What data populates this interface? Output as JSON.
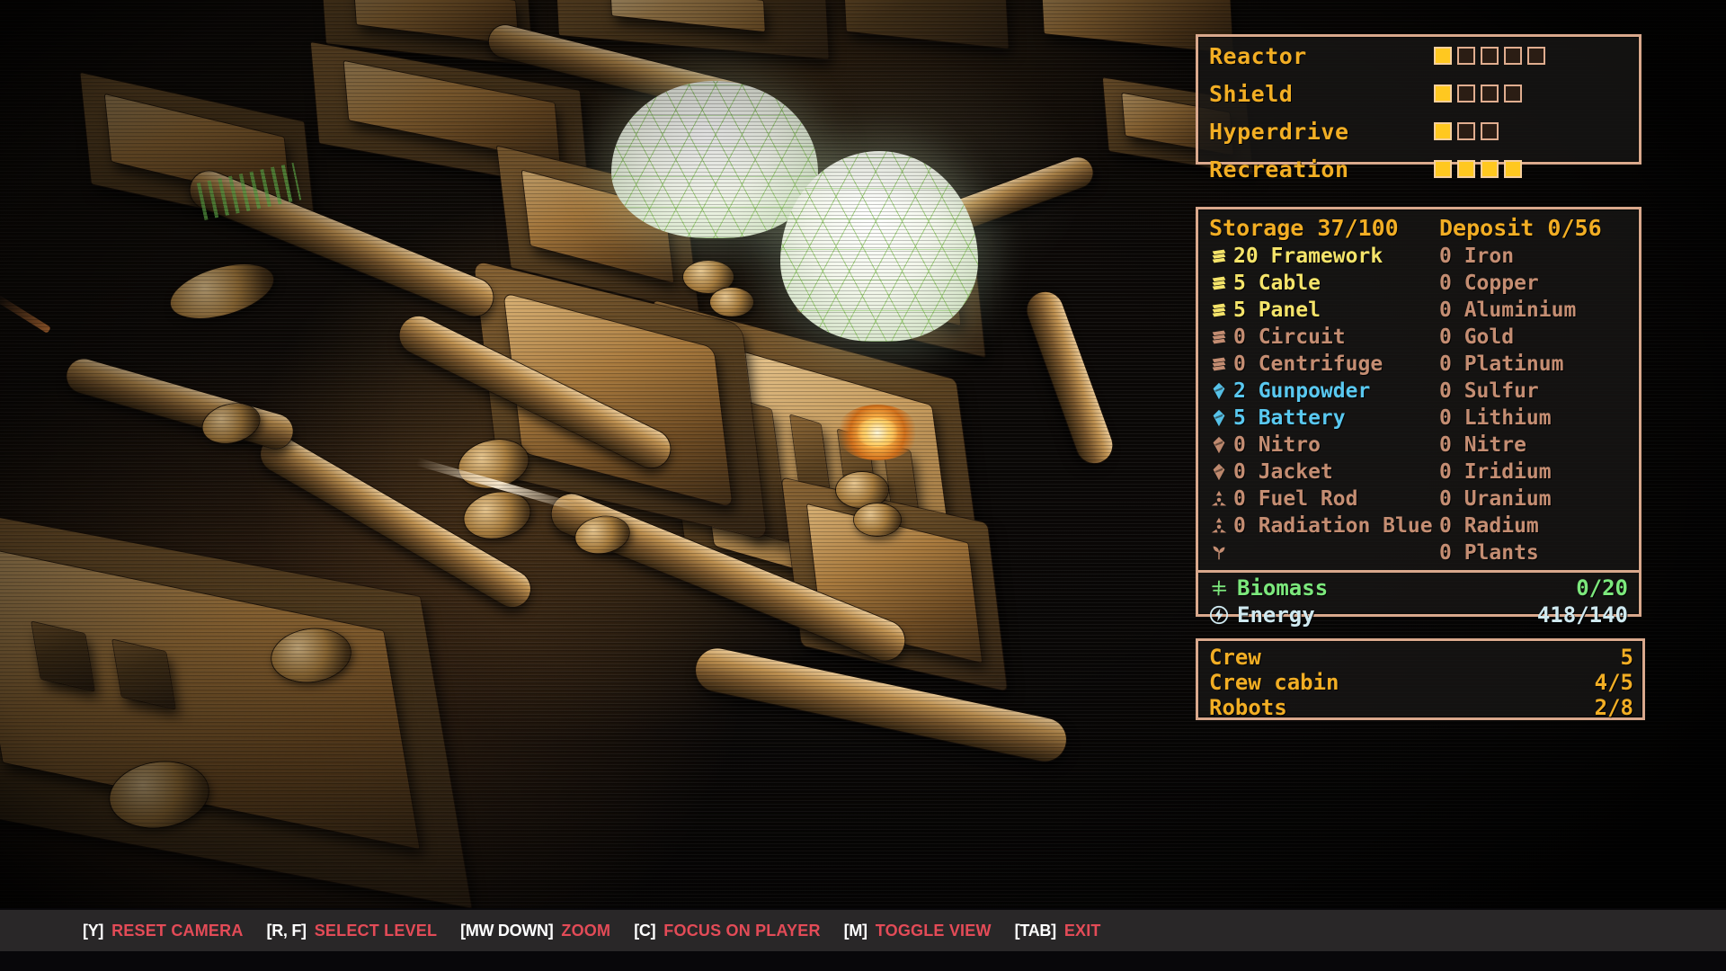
{
  "systems": {
    "rows": [
      {
        "label": "Reactor",
        "total": 5,
        "filled": 1
      },
      {
        "label": "Shield",
        "total": 4,
        "filled": 1
      },
      {
        "label": "Hyperdrive",
        "total": 3,
        "filled": 1
      },
      {
        "label": "Recreation",
        "total": 4,
        "filled": 4
      }
    ]
  },
  "resources": {
    "storage_header": "Storage 37/100",
    "deposit_header": "Deposit 0/56",
    "storage": [
      {
        "qty": "20",
        "name": "Framework",
        "icon": "stack-icon",
        "state": "active"
      },
      {
        "qty": "5",
        "name": "Cable",
        "icon": "stack-icon",
        "state": "active"
      },
      {
        "qty": "5",
        "name": "Panel",
        "icon": "stack-icon",
        "state": "active"
      },
      {
        "qty": "0",
        "name": "Circuit",
        "icon": "stack-icon",
        "state": "empty"
      },
      {
        "qty": "0",
        "name": "Centrifuge",
        "icon": "stack-icon",
        "state": "empty"
      },
      {
        "qty": "2",
        "name": "Gunpowder",
        "icon": "crystal-icon",
        "state": "charged"
      },
      {
        "qty": "5",
        "name": "Battery",
        "icon": "crystal-icon",
        "state": "charged"
      },
      {
        "qty": "0",
        "name": "Nitro",
        "icon": "crystal-icon",
        "state": "empty"
      },
      {
        "qty": "0",
        "name": "Jacket",
        "icon": "crystal-icon",
        "state": "empty"
      },
      {
        "qty": "0",
        "name": "Fuel Rod",
        "icon": "radiation-icon",
        "state": "empty"
      },
      {
        "qty": "0",
        "name": "Radiation Blue",
        "icon": "radiation-icon",
        "state": "empty"
      },
      {
        "qty": "",
        "name": "",
        "icon": "plant-icon",
        "state": "empty"
      }
    ],
    "deposit": [
      {
        "qty": "0",
        "name": "Iron"
      },
      {
        "qty": "0",
        "name": "Copper"
      },
      {
        "qty": "0",
        "name": "Aluminium"
      },
      {
        "qty": "0",
        "name": "Gold"
      },
      {
        "qty": "0",
        "name": "Platinum"
      },
      {
        "qty": "0",
        "name": "Sulfur"
      },
      {
        "qty": "0",
        "name": "Lithium"
      },
      {
        "qty": "0",
        "name": "Nitre"
      },
      {
        "qty": "0",
        "name": "Iridium"
      },
      {
        "qty": "0",
        "name": "Uranium"
      },
      {
        "qty": "0",
        "name": "Radium"
      },
      {
        "qty": "0",
        "name": "Plants"
      }
    ],
    "totals": [
      {
        "icon": "biomass-icon",
        "label": "Biomass",
        "value": "0/20",
        "color": "green"
      },
      {
        "icon": "energy-icon",
        "label": "Energy",
        "value": "418/140",
        "color": "white"
      }
    ]
  },
  "crew": {
    "rows": [
      {
        "label": "Crew",
        "value": "5"
      },
      {
        "label": "Crew cabin",
        "value": "4/5"
      },
      {
        "label": "Robots",
        "value": "2/8"
      }
    ]
  },
  "hotkeys": [
    {
      "key": "[Y]",
      "action": "RESET CAMERA"
    },
    {
      "key": "[R, F]",
      "action": "SELECT LEVEL"
    },
    {
      "key": "[MW DOWN]",
      "action": "ZOOM"
    },
    {
      "key": "[C]",
      "action": "FOCUS ON PLAYER"
    },
    {
      "key": "[M]",
      "action": "TOGGLE VIEW"
    },
    {
      "key": "[TAB]",
      "action": "EXIT"
    }
  ],
  "colors": {
    "panel_border": "#d9a88c",
    "panel_bg": "rgba(24,22,21,0.80)",
    "accent_amber": "#f2ae24",
    "resource_active": "#f5e46a",
    "resource_empty": "#c48d72",
    "resource_charged": "#59c8f0",
    "biomass_green": "#7ce87c",
    "energy_white": "#cfe9f0",
    "hotkey_action": "#e34b57",
    "pip_filled": "#ffc820"
  }
}
